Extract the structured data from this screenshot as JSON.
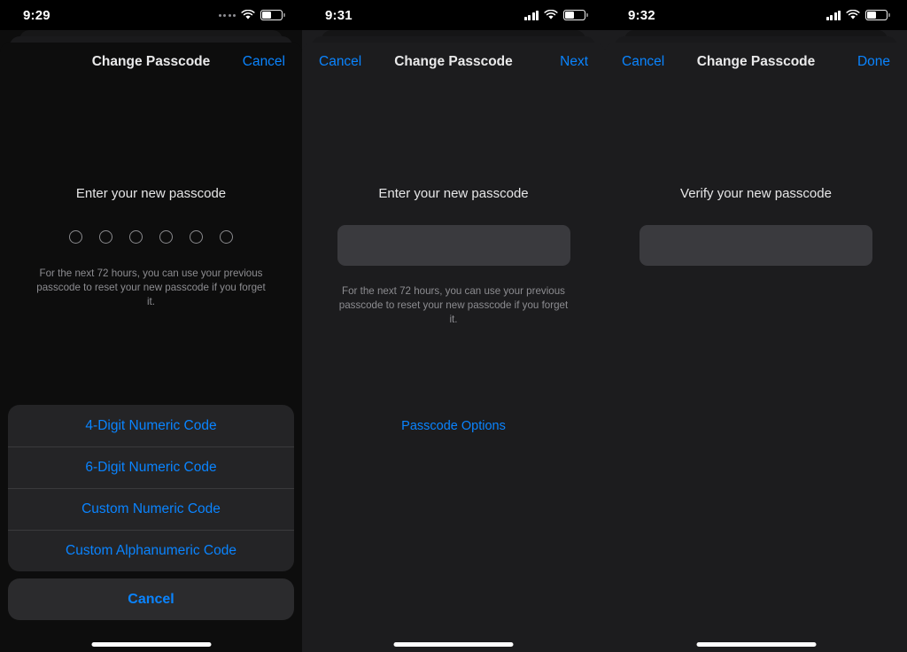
{
  "screens": [
    {
      "id": "passcode-options-sheet",
      "status": {
        "time": "9:29",
        "cellular": "no-service-dots",
        "wifi": "wifi-icon",
        "battery": "battery-icon"
      },
      "nav": {
        "left": "",
        "title": "Change Passcode",
        "right": "Cancel"
      },
      "body": {
        "prompt": "Enter your new passcode",
        "dots": 6,
        "hint": "For the next 72 hours, you can use your previous passcode to reset your new passcode if you forget it."
      },
      "action_sheet": {
        "options": [
          "4-Digit Numeric Code",
          "6-Digit Numeric Code",
          "Custom Numeric Code",
          "Custom Alphanumeric Code"
        ],
        "cancel": "Cancel"
      }
    },
    {
      "id": "enter-new-passcode",
      "status": {
        "time": "9:31",
        "cellular": "signal-bars",
        "wifi": "wifi-icon",
        "battery": "battery-icon"
      },
      "nav": {
        "left": "Cancel",
        "title": "Change Passcode",
        "right": "Next"
      },
      "body": {
        "prompt": "Enter your new passcode",
        "field_value": "",
        "hint": "For the next 72 hours, you can use your previous passcode to reset your new passcode if you forget it.",
        "options_link": "Passcode Options"
      }
    },
    {
      "id": "verify-new-passcode",
      "status": {
        "time": "9:32",
        "cellular": "signal-bars",
        "wifi": "wifi-icon",
        "battery": "battery-icon"
      },
      "nav": {
        "left": "Cancel",
        "title": "Change Passcode",
        "right": "Done"
      },
      "body": {
        "prompt": "Verify your new passcode",
        "field_value": ""
      }
    }
  ],
  "colors": {
    "accent_blue": "#0a84ff",
    "sheet_dark": "#0d0d0d",
    "sheet_gray": "#1c1c1e",
    "field_fill": "#3a3a3e",
    "action_group": "#242426",
    "primary_text": "#e9e9ea",
    "secondary_text": "#8c8c90"
  }
}
